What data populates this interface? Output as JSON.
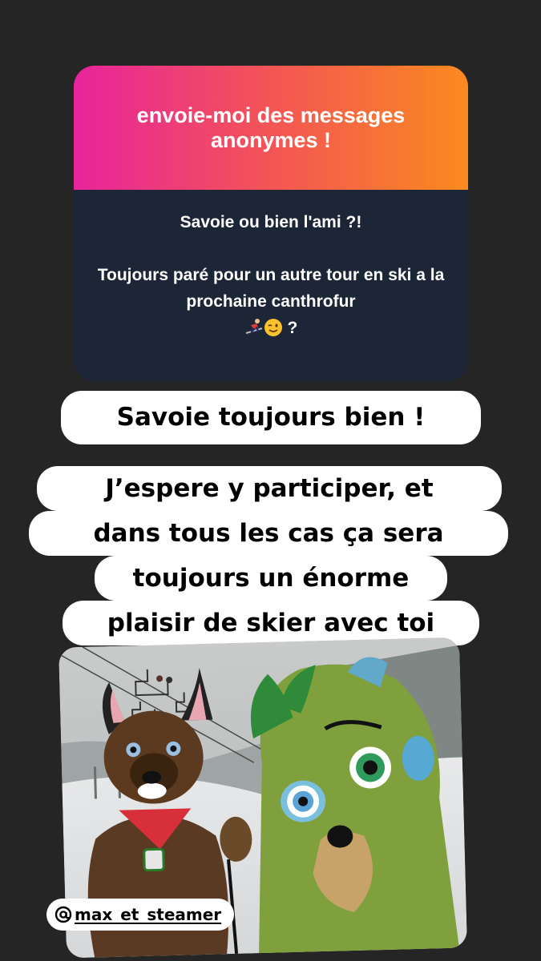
{
  "question_card": {
    "header": "envoie-moi des messages anonymes !",
    "question_line1": "Savoie ou bien l'ami ?!",
    "question_line2": "Toujours paré pour un autre tour en ski a la prochaine canthrofur",
    "question_end": "?",
    "emojis": [
      "skier-icon",
      "winking-face-icon"
    ]
  },
  "replies": [
    "Savoie toujours bien !",
    "J’espere y participer, et",
    "dans tous les cas ça sera",
    "toujours un énorme",
    "plaisir de skier avec toi",
    "=)"
  ],
  "mention": {
    "handle": "max_et_steamer"
  },
  "colors": {
    "background": "#252525",
    "card_body": "#1c2637",
    "gradient_start": "#e8249b",
    "gradient_end": "#fb8a1e"
  }
}
